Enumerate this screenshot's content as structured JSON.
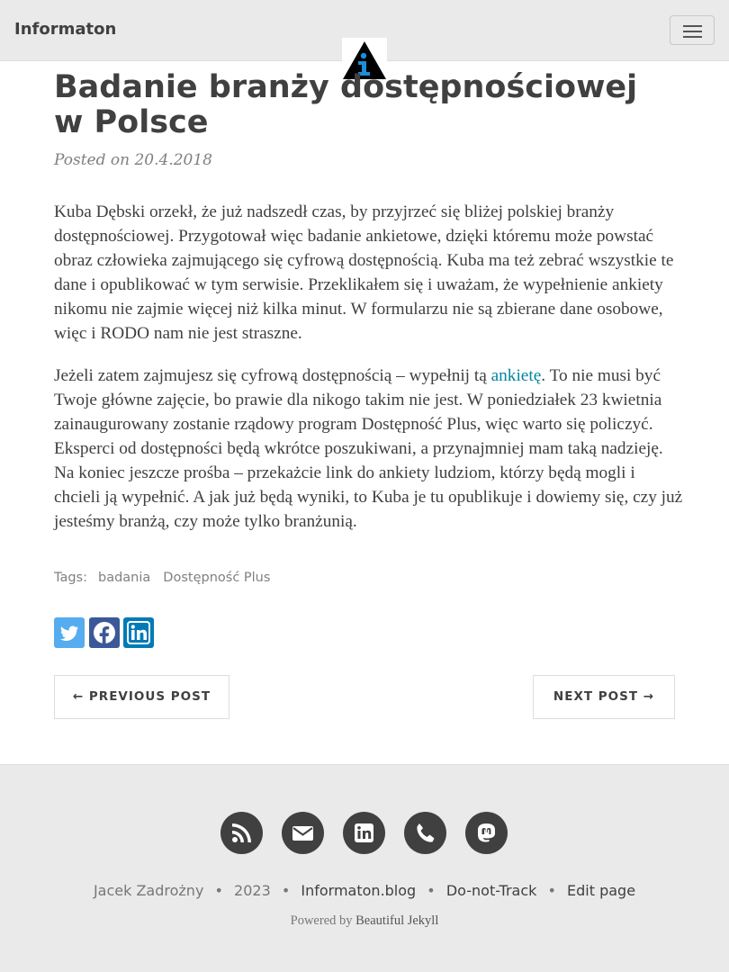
{
  "navbar": {
    "brand": "Informaton"
  },
  "post": {
    "title": "Badanie branży dostępnościowej w Polsce",
    "meta": "Posted on 20.4.2018",
    "paragraph1": "Kuba Dębski orzekł, że już nadszedł czas, by przyjrzeć się bliżej polskiej branży dostępnościowej. Przygotował więc badanie ankietowe, dzięki któremu może powstać obraz człowieka zajmującego się cyfrową dostępnością. Kuba ma też zebrać wszystkie te dane i opublikować w tym serwisie. Przeklikałem się i uważam, że wypełnienie ankiety nikomu nie zajmie więcej niż kilka minut. W formularzu nie są zbierane dane osobowe, więc i RODO nam nie jest straszne.",
    "paragraph2_before_link": "Jeżeli zatem zajmujesz się cyfrową dostępnością – wypełnij tą ",
    "paragraph2_link": "ankietę",
    "paragraph2_after_link": ". To nie musi być Twoje główne zajęcie, bo prawie dla nikogo takim nie jest. W poniedziałek 23 kwietnia zainaugurowany zostanie rządowy program Dostępność Plus, więc warto się policzyć. Eksperci od dostępności będą wkrótce poszukiwani, a przynajmniej mam taką nadzieję. Na koniec jeszcze prośba – przekażcie link do ankiety ludziom, którzy będą mogli i chcieli ją wypełnić. A jak już będą wyniki, to Kuba je tu opublikuje i dowiemy się, czy już jesteśmy branżą, czy może tylko branżunią."
  },
  "tags": {
    "label": "Tags:",
    "items": [
      "badania",
      "Dostępność Plus"
    ]
  },
  "share": {
    "icons": [
      "twitter-icon",
      "facebook-icon",
      "linkedin-icon"
    ],
    "colors": {
      "twitter": "#55acee",
      "facebook": "#3b5998",
      "linkedin": "#007bb5"
    }
  },
  "pager": {
    "previous": "← PREVIOUS POST",
    "next": "NEXT POST →"
  },
  "footer": {
    "icons": [
      "rss-icon",
      "email-icon",
      "linkedin-icon",
      "phone-icon",
      "mastodon-icon"
    ],
    "author": "Jacek Zadrożny",
    "year": "2023",
    "sep": "•",
    "links": [
      "Informaton.blog",
      "Do-not-Track",
      "Edit page"
    ],
    "powered_prefix": "Powered by ",
    "powered_link": "Beautiful Jekyll"
  },
  "colors": {
    "text": "#404040",
    "link": "#0085a1",
    "navbar_bg": "#eaeaea",
    "footer_bg": "#eaeaea"
  }
}
